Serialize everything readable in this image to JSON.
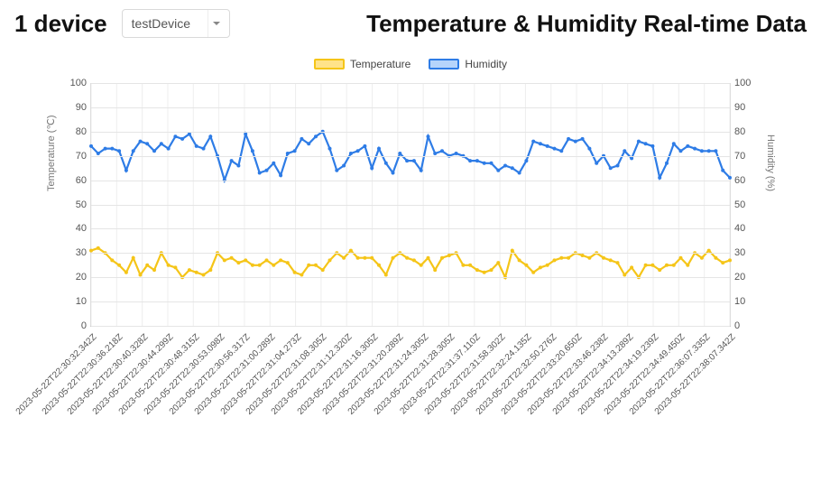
{
  "header": {
    "device_count_label": "1 device",
    "device_selected": "testDevice",
    "title": "Temperature & Humidity Real-time Data"
  },
  "legend": {
    "temp_label": "Temperature",
    "hum_label": "Humidity"
  },
  "axes": {
    "y_left_label": "Temperature (℃)",
    "y_right_label": "Humidity (%)"
  },
  "colors": {
    "temperature": "#f5c518",
    "humidity": "#2e7ce6"
  },
  "chart_data": {
    "type": "line",
    "ylim": [
      0,
      100
    ],
    "yticks": [
      0,
      10,
      20,
      30,
      40,
      50,
      60,
      70,
      80,
      90,
      100
    ],
    "xlabel": "",
    "ylabel_left": "Temperature (℃)",
    "ylabel_right": "Humidity (%)",
    "categories": [
      "2023-05-22T22:30:32.342Z",
      "2023-05-22T22:30:36.218Z",
      "2023-05-22T22:30:40.328Z",
      "2023-05-22T22:30:44.299Z",
      "2023-05-22T22:30:48.315Z",
      "2023-05-22T22:30:53.098Z",
      "2023-05-22T22:30:56.317Z",
      "2023-05-22T22:31:00.289Z",
      "2023-05-22T22:31:04.273Z",
      "2023-05-22T22:31:08.305Z",
      "2023-05-22T22:31:12.320Z",
      "2023-05-22T22:31:16.305Z",
      "2023-05-22T22:31:20.289Z",
      "2023-05-22T22:31:24.305Z",
      "2023-05-22T22:31:28.305Z",
      "2023-05-22T22:31:37.110Z",
      "2023-05-22T22:31:58.302Z",
      "2023-05-22T22:32:24.135Z",
      "2023-05-22T22:32:50.276Z",
      "2023-05-22T22:33:20.650Z",
      "2023-05-22T22:33:46.238Z",
      "2023-05-22T22:34:13.289Z",
      "2023-05-22T22:34:19.239Z",
      "2023-05-22T22:34:49.450Z",
      "2023-05-22T22:36:07.335Z",
      "2023-05-22T22:38:07.342Z"
    ],
    "series": [
      {
        "name": "Temperature",
        "values": [
          31,
          32,
          30,
          27,
          25,
          22,
          28,
          21,
          25,
          23,
          30,
          25,
          24,
          20,
          23,
          22,
          21,
          23,
          30,
          27,
          28,
          26,
          27,
          25,
          25,
          27,
          25,
          27,
          26,
          22,
          21,
          25,
          25,
          23,
          27,
          30,
          28,
          31,
          28,
          28,
          28,
          25,
          21,
          28,
          30,
          28,
          27,
          25,
          28,
          23,
          28,
          29,
          30,
          25,
          25,
          23,
          22,
          23,
          26,
          20,
          31,
          27,
          25,
          22,
          24,
          25,
          27,
          28,
          28,
          30,
          29,
          28,
          30,
          28,
          27,
          26,
          21,
          24,
          20,
          25,
          25,
          23,
          25,
          25,
          28,
          25,
          30,
          28,
          31,
          28,
          26,
          27
        ]
      },
      {
        "name": "Humidity",
        "values": [
          74,
          71,
          73,
          73,
          72,
          64,
          72,
          76,
          75,
          72,
          75,
          73,
          78,
          77,
          79,
          74,
          73,
          78,
          70,
          60,
          68,
          66,
          79,
          72,
          63,
          64,
          67,
          62,
          71,
          72,
          77,
          75,
          78,
          80,
          73,
          64,
          66,
          71,
          72,
          74,
          65,
          73,
          67,
          63,
          71,
          68,
          68,
          64,
          78,
          71,
          72,
          70,
          71,
          70,
          68,
          68,
          67,
          67,
          64,
          66,
          65,
          63,
          68,
          76,
          75,
          74,
          73,
          72,
          77,
          76,
          77,
          73,
          67,
          70,
          65,
          66,
          72,
          69,
          76,
          75,
          74,
          61,
          67,
          75,
          72,
          74,
          73,
          72,
          72,
          72,
          64,
          61
        ]
      }
    ]
  }
}
